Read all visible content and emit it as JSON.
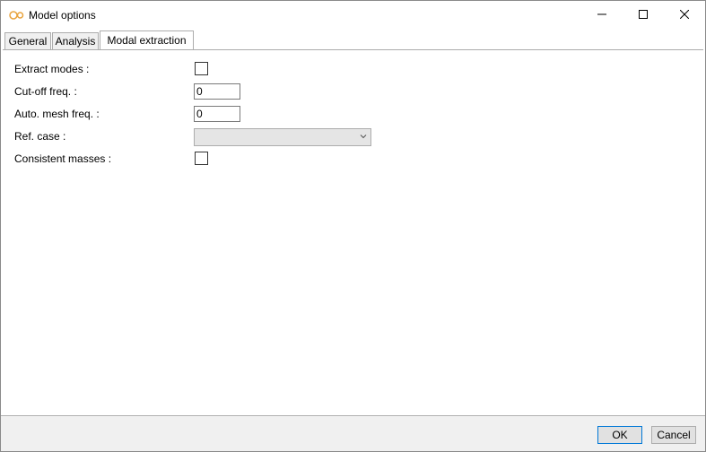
{
  "window": {
    "title": "Model options",
    "controls": {
      "minimize": "minimize-icon",
      "maximize": "maximize-icon",
      "close": "close-icon"
    }
  },
  "tabs": [
    {
      "label": "General",
      "active": false
    },
    {
      "label": "Analysis",
      "active": false
    },
    {
      "label": "Modal extraction",
      "active": true
    }
  ],
  "form": {
    "extract_modes": {
      "label": "Extract modes :",
      "checked": false
    },
    "cutoff_freq": {
      "label": "Cut-off freq. :",
      "value": "0"
    },
    "auto_mesh_freq": {
      "label": "Auto. mesh freq. :",
      "value": "0"
    },
    "ref_case": {
      "label": "Ref. case :",
      "value": ""
    },
    "consistent_masses": {
      "label": "Consistent masses :",
      "checked": false
    }
  },
  "footer": {
    "ok_label": "OK",
    "cancel_label": "Cancel"
  },
  "colors": {
    "accent": "#0078d7",
    "footer_bg": "#f0f0f0",
    "icon_orange": "#e8a33d"
  }
}
